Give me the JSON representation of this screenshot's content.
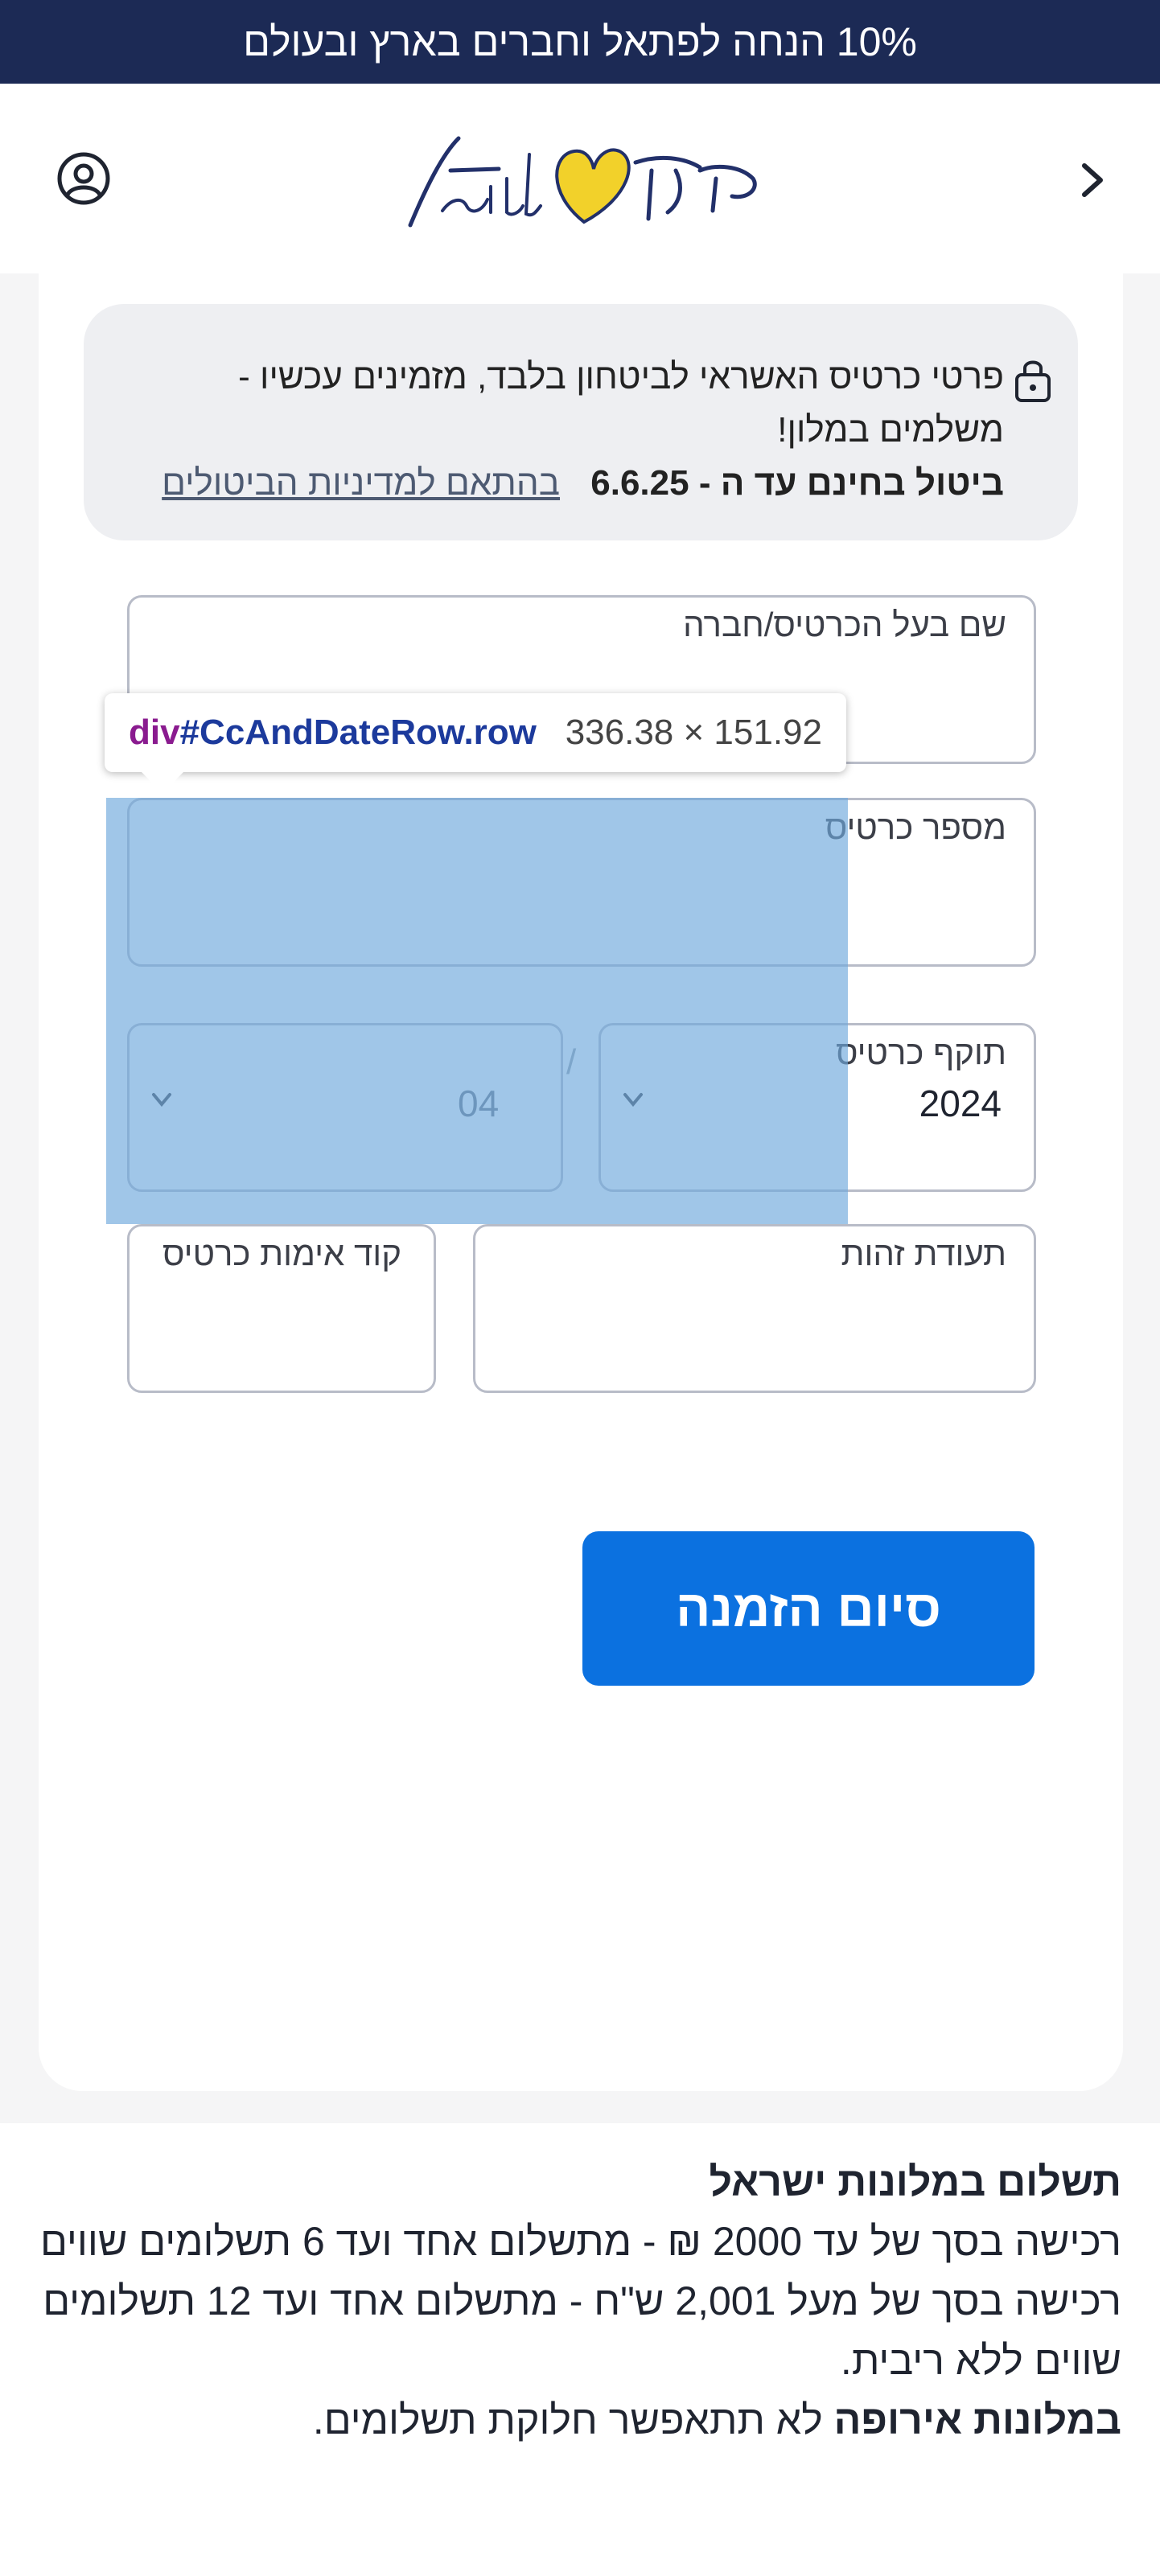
{
  "promo": {
    "text": "10% הנחה לפתאל וחברים בארץ ובעולם"
  },
  "header": {
    "logo_alt": "fattal פתאל"
  },
  "notice": {
    "text": "פרטי כרטיס האשראי לביטחון בלבד, מזמינים עכשיו - משלמים במלון!",
    "cancel_text": "ביטול בחינם עד ה - 6.6.25",
    "policy_link": "בהתאם למדיניות הביטולים"
  },
  "form": {
    "card_holder_label": "שם בעל הכרטיס/חברה",
    "card_number_label": "מספר כרטיס",
    "expiry_label": "תוקף כרטיס",
    "expiry_year": "2024",
    "expiry_month": "04",
    "separator": "/",
    "id_label": "תעודת זהות",
    "cvv_label": "קוד אימות כרטיס",
    "submit_label": "סיום הזמנה"
  },
  "inspector": {
    "tag": "div",
    "selector": "#CcAndDateRow.row",
    "dimensions": "336.38 × 151.92"
  },
  "payment_info": {
    "heading": "תשלום במלונות ישראל",
    "line1": "רכישה בסך של עד 2000 ₪ - מתשלום אחד ועד 6 תשלומים שווים",
    "line2": "רכישה בסך של מעל 2,001 ש\"ח  - מתשלום אחד ועד 12 תשלומים שווים ללא ריבית.",
    "europe_bold": "במלונות אירופה",
    "europe_rest": " לא תתאפשר חלוקת תשלומים."
  },
  "colors": {
    "promo_bg": "#1c2a55",
    "submit_bg": "#0b71e0",
    "logo_heart": "#f2d12a",
    "inspector_overlay": "#6fa8dc"
  },
  "icons": [
    "chevron-right-icon",
    "user-circle-icon",
    "lock-icon",
    "chevron-down-icon"
  ]
}
